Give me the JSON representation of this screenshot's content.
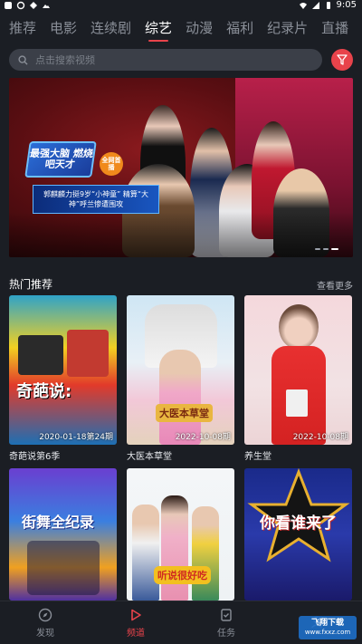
{
  "status": {
    "time": "9:05"
  },
  "tabs": [
    {
      "label": "推荐",
      "active": false
    },
    {
      "label": "电影",
      "active": false
    },
    {
      "label": "连续剧",
      "active": false
    },
    {
      "label": "综艺",
      "active": true
    },
    {
      "label": "动漫",
      "active": false
    },
    {
      "label": "福利",
      "active": false
    },
    {
      "label": "纪录片",
      "active": false
    },
    {
      "label": "直播",
      "active": false
    }
  ],
  "search": {
    "placeholder": "点击搜索视频"
  },
  "banner": {
    "logo_text": "最强大脑 燃烧吧天才",
    "live_badge": "全网首播",
    "caption": "郭麒麟力挺9岁“小神童” 精算“大神”呼兰惨遭围攻"
  },
  "section": {
    "title": "热门推荐",
    "more_label": "查看更多"
  },
  "cards": [
    {
      "name": "奇葩说第6季",
      "date": "2020-01-18第24期",
      "poster_title": "奇葩说:"
    },
    {
      "name": "大医本草堂",
      "date": "2022-10-08期",
      "poster_title": "大医本草堂"
    },
    {
      "name": "养生堂",
      "date": "2022-10-08期",
      "poster_title": ""
    },
    {
      "name": "",
      "date": "",
      "poster_title": "街舞全纪录"
    },
    {
      "name": "",
      "date": "",
      "poster_title": "听说很好吃"
    },
    {
      "name": "",
      "date": "",
      "poster_title": "你看谁来了"
    }
  ],
  "nav": [
    {
      "label": "发现",
      "icon": "compass-icon",
      "active": false
    },
    {
      "label": "频道",
      "icon": "play-icon",
      "active": true
    },
    {
      "label": "任务",
      "icon": "task-icon",
      "active": false
    },
    {
      "label": "",
      "icon": "user-icon",
      "active": false
    }
  ],
  "watermark": {
    "line1": "飞翔下载",
    "line2": "www.fxxz.com"
  },
  "colors": {
    "accent": "#e8434b",
    "background": "#1b1e24",
    "search_bg": "#3b3f48"
  }
}
